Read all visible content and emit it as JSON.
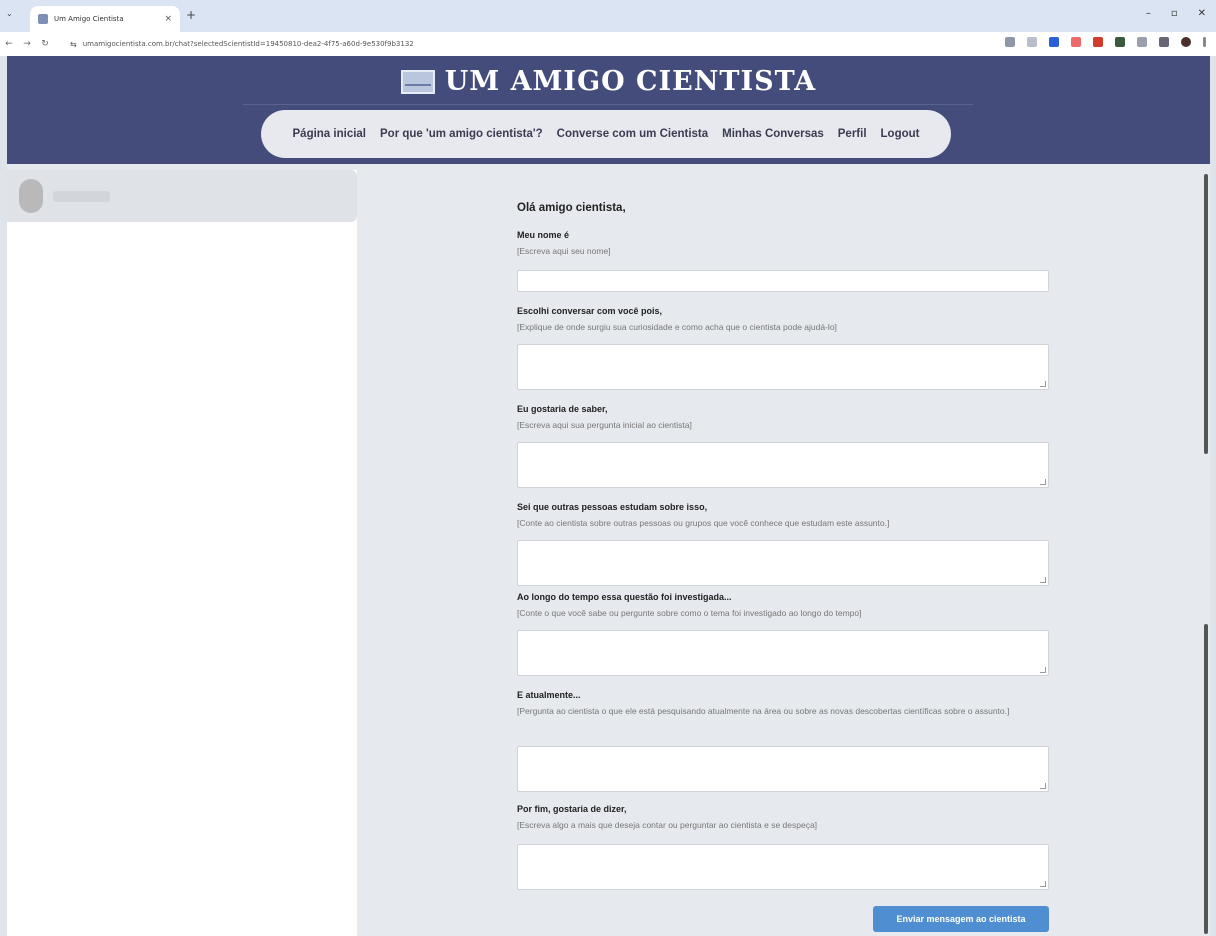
{
  "browser": {
    "tab_title": "Um Amigo Cientista",
    "tab_close": "×",
    "new_tab": "+",
    "tabs_menu": "⌄",
    "url": "umamigocientista.com.br/chat?selectedScientistId=19450810-dea2-4f75-a60d-9e530f9b3132",
    "site_info_icon": "⇆",
    "window_min": "–",
    "window_max": "▫",
    "window_close": "✕",
    "back_icon": "←",
    "forward_icon": "→",
    "reload_icon": "↻"
  },
  "header": {
    "site_title": "UM AMIGO CIENTISTA",
    "nav": [
      {
        "label": "Página inicial"
      },
      {
        "label": "Por que 'um amigo cientista'?"
      },
      {
        "label": "Converse com um Cientista"
      },
      {
        "label": "Minhas Conversas"
      },
      {
        "label": "Perfil"
      },
      {
        "label": "Logout"
      }
    ]
  },
  "form": {
    "greeting": "Olá amigo cientista,",
    "fields": [
      {
        "label": "Meu nome é",
        "hint": "[Escreva aqui seu nome]"
      },
      {
        "label": "Escolhi conversar com você pois,",
        "hint": "[Explique de onde surgiu sua curiosidade e como acha que o cientista pode ajudá-lo]"
      },
      {
        "label": "Eu gostaria de saber,",
        "hint": "[Escreva aqui sua pergunta inicial ao cientista]"
      },
      {
        "label": "Sei que outras pessoas estudam sobre isso,",
        "hint": "[Conte ao cientista sobre outras pessoas ou grupos que você conhece que estudam este assunto.]"
      },
      {
        "label": "Ao longo do tempo essa questão foi investigada...",
        "hint": "[Conte o que você sabe ou pergunte sobre como o tema foi investigado ao longo do tempo]"
      },
      {
        "label": "E atualmente...",
        "hint": "[Pergunta ao cientista o que ele está pesquisando atualmente na área ou sobre as novas descobertas científicas sobre o assunto.]"
      },
      {
        "label": "Por fim, gostaria de dizer,",
        "hint": "[Escreva algo a mais que deseja contar ou perguntar ao cientista e se despeça]"
      }
    ],
    "submit_label": "Enviar mensagem ao cientista"
  }
}
